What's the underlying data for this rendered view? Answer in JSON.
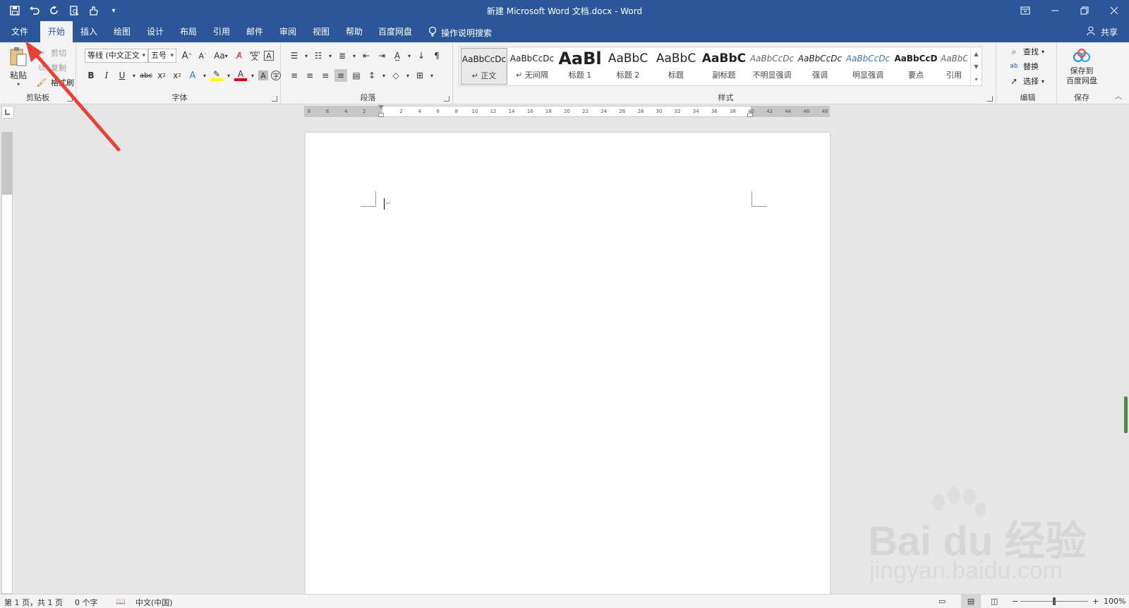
{
  "window": {
    "title": "新建 Microsoft Word 文档.docx  -  Word"
  },
  "tabs": [
    {
      "label": "文件"
    },
    {
      "label": "开始"
    },
    {
      "label": "插入"
    },
    {
      "label": "绘图"
    },
    {
      "label": "设计"
    },
    {
      "label": "布局"
    },
    {
      "label": "引用"
    },
    {
      "label": "邮件"
    },
    {
      "label": "审阅"
    },
    {
      "label": "视图"
    },
    {
      "label": "帮助"
    },
    {
      "label": "百度网盘"
    }
  ],
  "active_tab": "开始",
  "tell_me": "操作说明搜索",
  "share": "共享",
  "clipboard": {
    "paste": "粘贴",
    "cut": "剪切",
    "copy": "复制",
    "format_painter": "格式刷",
    "group_label": "剪贴板"
  },
  "font": {
    "font_name": "等线 (中文正文",
    "font_size": "五号",
    "group_label": "字体",
    "change_case": "Aa",
    "phonetic_top": "wén",
    "phonetic_bottom": "文"
  },
  "paragraph": {
    "group_label": "段落"
  },
  "styles": {
    "group_label": "样式",
    "items": [
      {
        "sample": "AaBbCcDc",
        "name": "↵ 正文"
      },
      {
        "sample": "AaBbCcDc",
        "name": "↵ 无间隔"
      },
      {
        "sample": "AaBl",
        "name": "标题 1"
      },
      {
        "sample": "AaBbC",
        "name": "标题 2"
      },
      {
        "sample": "AaBbC",
        "name": "标题"
      },
      {
        "sample": "AaBbC",
        "name": "副标题"
      },
      {
        "sample": "AaBbCcDc",
        "name": "不明显强调"
      },
      {
        "sample": "AaBbCcDc",
        "name": "强调"
      },
      {
        "sample": "AaBbCcDc",
        "name": "明显强调"
      },
      {
        "sample": "AaBbCcD",
        "name": "要点"
      },
      {
        "sample": "AaBbCcDc",
        "name": "引用"
      }
    ]
  },
  "editing": {
    "find": "查找",
    "replace": "替换",
    "select": "选择",
    "group_label": "编辑"
  },
  "save_group": {
    "save_to_baidu_line1": "保存到",
    "save_to_baidu_line2": "百度网盘",
    "group_label": "保存"
  },
  "ruler_numbers": [
    "8",
    "6",
    "4",
    "2",
    "",
    "2",
    "4",
    "6",
    "8",
    "10",
    "12",
    "14",
    "16",
    "18",
    "20",
    "22",
    "24",
    "26",
    "28",
    "30",
    "32",
    "34",
    "36",
    "38",
    "40",
    "42",
    "44",
    "46",
    "48"
  ],
  "status": {
    "page": "第 1 页，共 1 页",
    "words": "0 个字",
    "language": "中文(中国)",
    "zoom": "100%"
  },
  "watermark": {
    "line1": "Bai du 经验",
    "line2": "jingyan.baidu.com"
  },
  "colors": {
    "brand": "#2b579a",
    "annotation_arrow": "#e8413a",
    "highlight": "#ffff00",
    "font_color": "#e00000"
  }
}
